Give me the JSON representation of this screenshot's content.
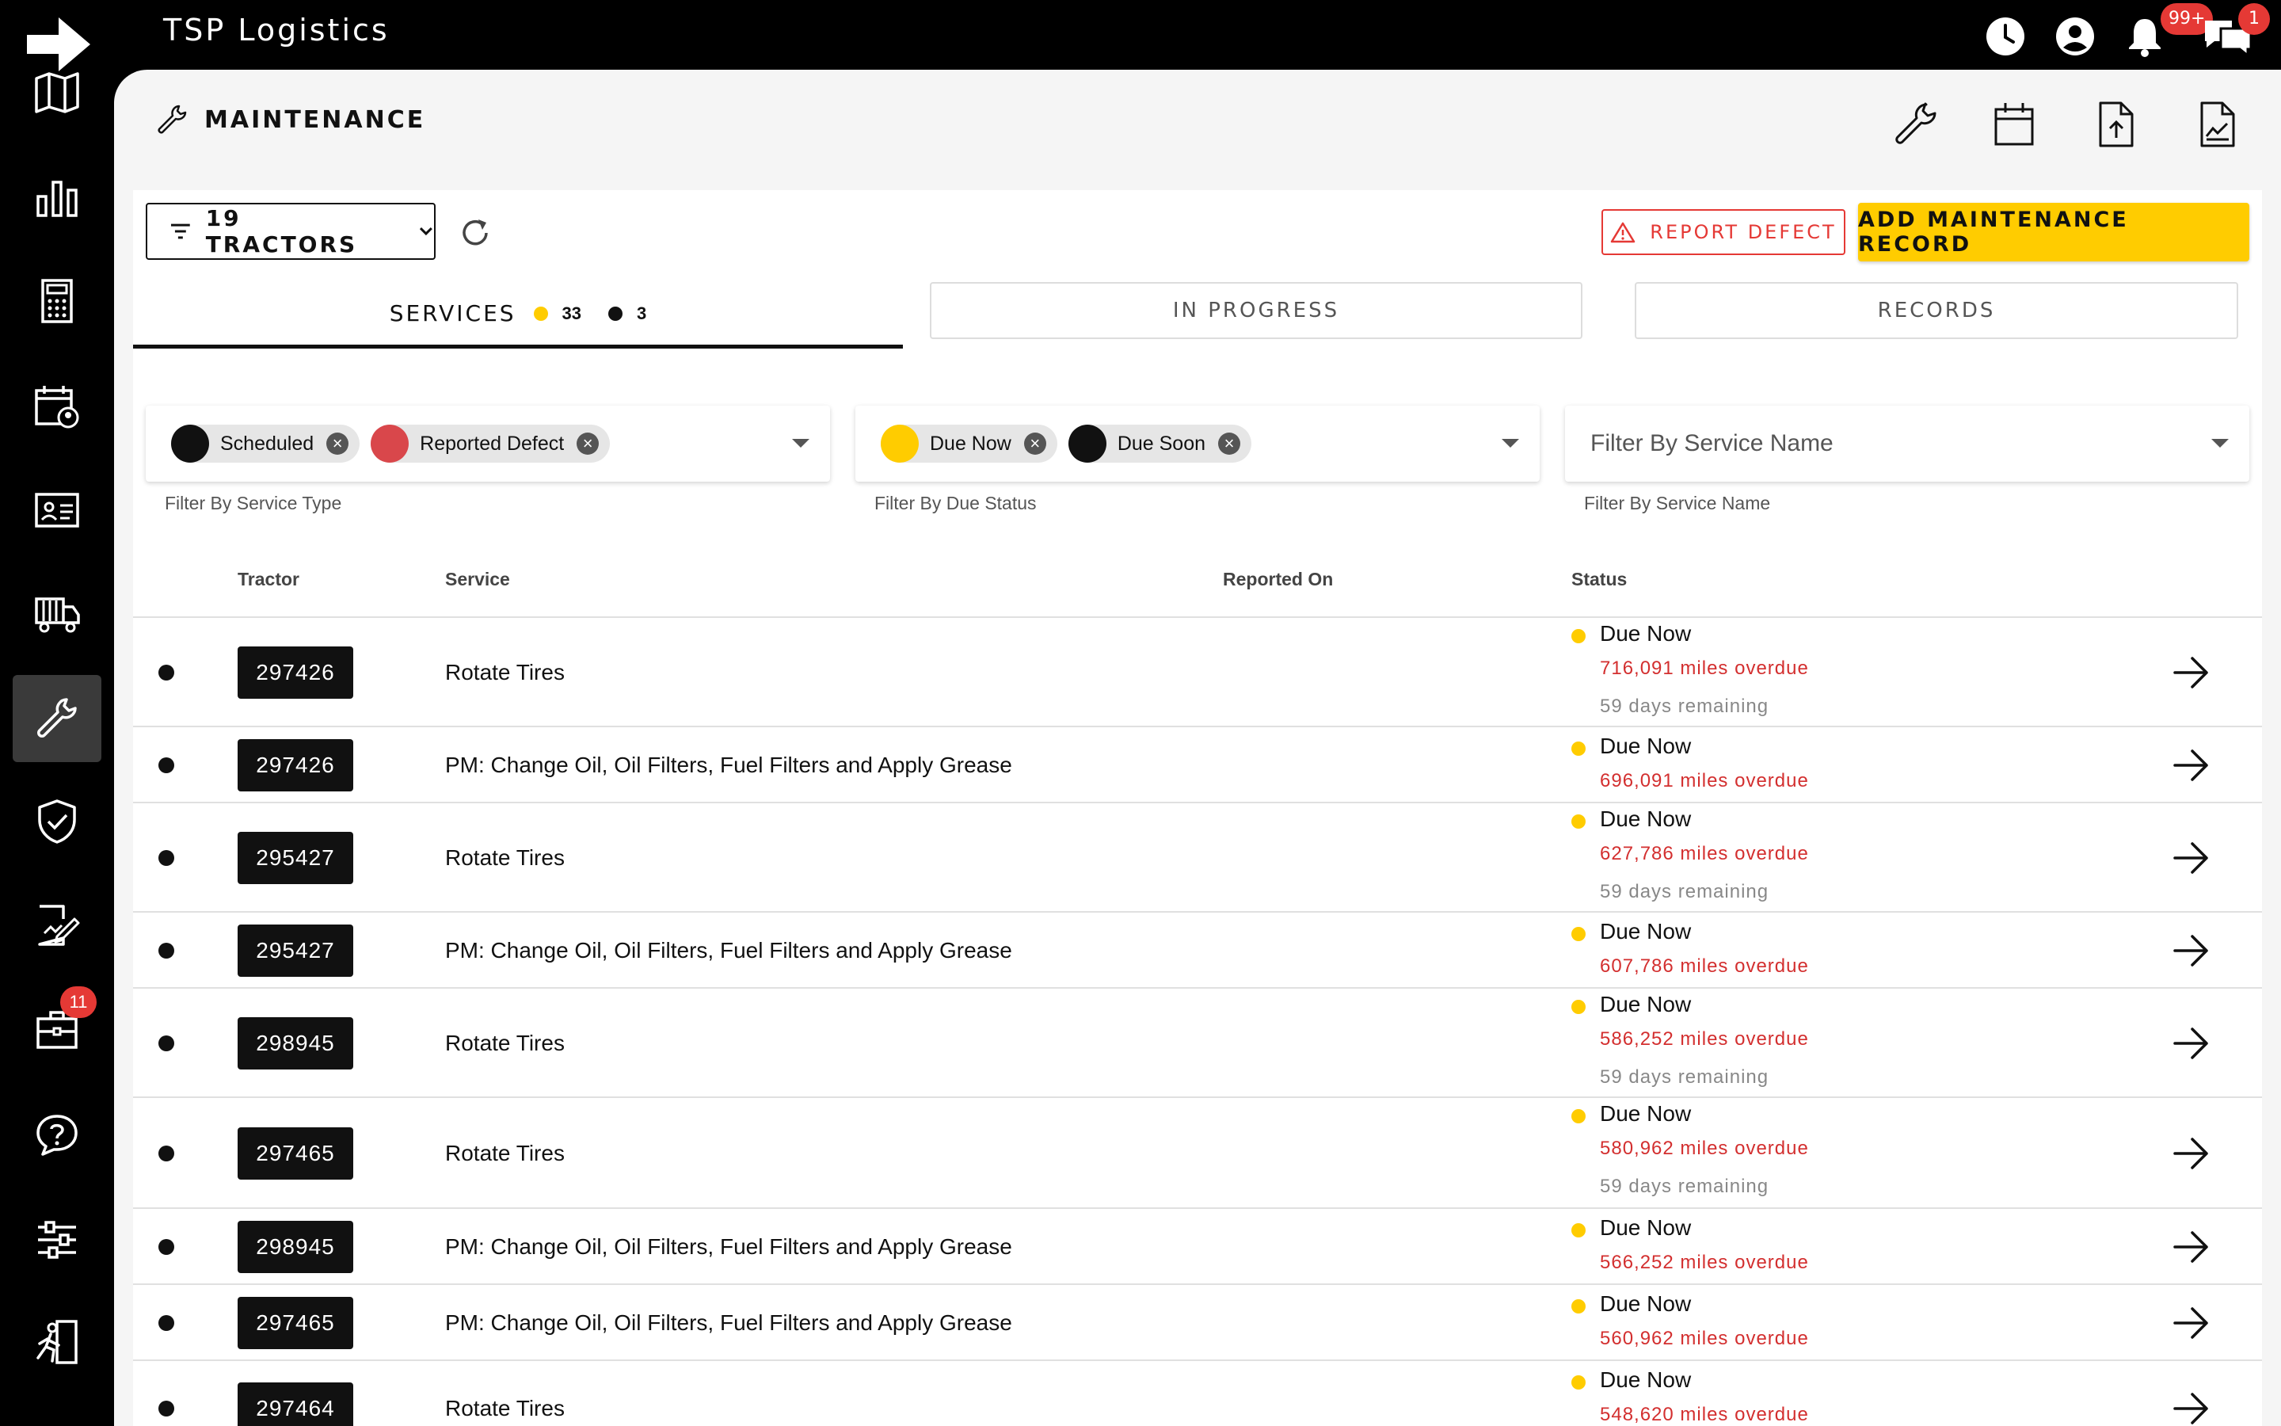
{
  "app": {
    "title": "TSP Logistics"
  },
  "topbar": {
    "notifications_badge": "99+",
    "messages_badge": "1"
  },
  "sidebar": {
    "dispatch_badge": "11"
  },
  "page": {
    "title": "MAINTENANCE"
  },
  "toolbar": {
    "tractors_label": "19 TRACTORS",
    "report_defect_label": "REPORT DEFECT",
    "add_record_label": "ADD MAINTENANCE RECORD"
  },
  "tabs": {
    "services": {
      "label": "SERVICES",
      "due_now_count": "33",
      "due_soon_count": "3"
    },
    "in_progress": {
      "label": "IN PROGRESS"
    },
    "records": {
      "label": "RECORDS"
    }
  },
  "filters": {
    "service_type": {
      "chips": [
        "Scheduled",
        "Reported Defect"
      ],
      "help": "Filter By Service Type"
    },
    "due_status": {
      "chips": [
        "Due Now",
        "Due Soon"
      ],
      "help": "Filter By Due Status"
    },
    "service_name": {
      "placeholder": "Filter By Service Name",
      "help": "Filter By Service Name"
    }
  },
  "table": {
    "headers": {
      "tractor": "Tractor",
      "service": "Service",
      "reported_on": "Reported On",
      "status": "Status"
    },
    "rows": [
      {
        "tractor": "297426",
        "service": "Rotate Tires",
        "status": "Due Now",
        "miles": "716,091 miles overdue",
        "days": "59 days remaining"
      },
      {
        "tractor": "297426",
        "service": "PM: Change Oil, Oil Filters, Fuel Filters and Apply Grease",
        "status": "Due Now",
        "miles": "696,091 miles overdue",
        "days": ""
      },
      {
        "tractor": "295427",
        "service": "Rotate Tires",
        "status": "Due Now",
        "miles": "627,786 miles overdue",
        "days": "59 days remaining"
      },
      {
        "tractor": "295427",
        "service": "PM: Change Oil, Oil Filters, Fuel Filters and Apply Grease",
        "status": "Due Now",
        "miles": "607,786 miles overdue",
        "days": ""
      },
      {
        "tractor": "298945",
        "service": "Rotate Tires",
        "status": "Due Now",
        "miles": "586,252 miles overdue",
        "days": "59 days remaining"
      },
      {
        "tractor": "297465",
        "service": "Rotate Tires",
        "status": "Due Now",
        "miles": "580,962 miles overdue",
        "days": "59 days remaining"
      },
      {
        "tractor": "298945",
        "service": "PM: Change Oil, Oil Filters, Fuel Filters and Apply Grease",
        "status": "Due Now",
        "miles": "566,252 miles overdue",
        "days": ""
      },
      {
        "tractor": "297465",
        "service": "PM: Change Oil, Oil Filters, Fuel Filters and Apply Grease",
        "status": "Due Now",
        "miles": "560,962 miles overdue",
        "days": ""
      },
      {
        "tractor": "297464",
        "service": "Rotate Tires",
        "status": "Due Now",
        "miles": "548,620 miles overdue",
        "days": ""
      }
    ]
  },
  "colors": {
    "accent": "#ffcc00",
    "danger": "#e53935",
    "dark": "#111111"
  },
  "icons": [
    "arrow-right-logo-icon",
    "clock-icon",
    "account-icon",
    "bell-icon",
    "chat-icon",
    "map-icon",
    "bar-chart-icon",
    "calculator-icon",
    "calendar-user-icon",
    "id-card-icon",
    "truck-icon",
    "wrench-icon",
    "shield-check-icon",
    "document-edit-icon",
    "briefcase-icon",
    "help-chat-icon",
    "sliders-icon",
    "person-running-icon",
    "calendar-icon",
    "file-upload-icon",
    "file-chart-icon",
    "filter-icon",
    "refresh-icon",
    "warning-icon"
  ]
}
